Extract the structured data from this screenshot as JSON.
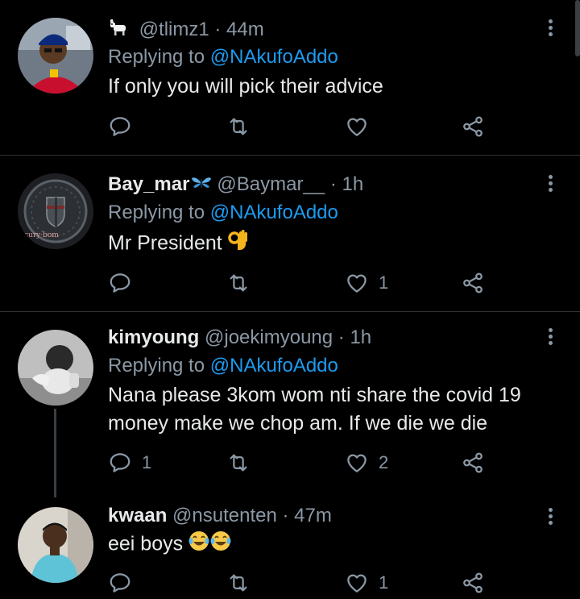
{
  "tweets": [
    {
      "display_name": "",
      "name_emoji": "goat-emoji",
      "handle": "@tlimz1",
      "time": "· 44m",
      "replying_label": "Replying to",
      "replying_handle": "@NAkufoAddo",
      "text": "If only you will pick their advice",
      "replies": "",
      "likes": ""
    },
    {
      "display_name": "Bay_mar",
      "name_emoji": "butterfly-emoji",
      "handle": "@Baymar__",
      "time": "· 1h",
      "replying_label": "Replying to",
      "replying_handle": "@NAkufoAddo",
      "text": "Mr President",
      "text_emoji": "ok-hand-emoji",
      "avatar_text": "cury·bom",
      "replies": "",
      "likes": "1"
    },
    {
      "display_name": "kimyoung",
      "handle": "@joekimyoung",
      "time": "· 1h",
      "replying_label": "Replying to",
      "replying_handle": "@NAkufoAddo",
      "text": "Nana please 3kom wom nti share the covid 19 money make we chop am. If we die we die",
      "replies": "1",
      "likes": "2"
    },
    {
      "display_name": "kwaan",
      "handle": "@nsutenten",
      "time": "· 47m",
      "text": "eei boys",
      "text_emoji": "tears-of-joy-emoji",
      "replies": "",
      "likes": "1"
    }
  ],
  "colors": {
    "background": "#000000",
    "primary_text": "#e7e9ea",
    "secondary_text": "#8b98a5",
    "link": "#1d9bf0",
    "divider": "#2f3336"
  }
}
